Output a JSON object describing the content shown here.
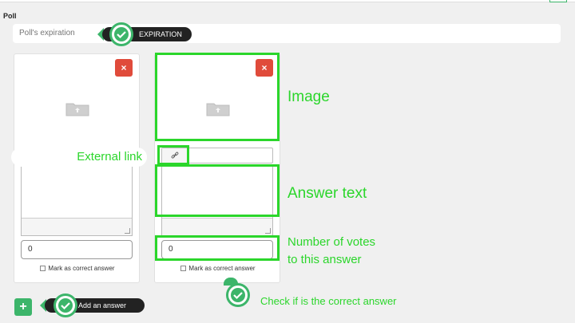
{
  "section": {
    "label": "Poll"
  },
  "expiration": {
    "placeholder": "Poll's expiration",
    "tag": "EXPIRATION"
  },
  "cards": [
    {
      "votes": "0",
      "correct_label": "Mark as correct answer",
      "remove_label": "×"
    },
    {
      "votes": "0",
      "correct_label": "Mark as correct answer",
      "remove_label": "×"
    }
  ],
  "add_answer": {
    "button_label": "+",
    "tag": "Add an answer"
  },
  "annotations": {
    "image": "Image",
    "external_link": "External link",
    "answer_text": "Answer text",
    "votes_line1": "Number of votes",
    "votes_line2": "to this answer",
    "correct": "Check if is the correct answer"
  },
  "colors": {
    "accent_green": "#3cb56a",
    "highlight_green": "#2bd62b",
    "remove_red": "#e04b3b"
  },
  "icons": [
    "check-icon",
    "folder-upload-icon",
    "link-icon",
    "close-icon",
    "plus-icon"
  ]
}
